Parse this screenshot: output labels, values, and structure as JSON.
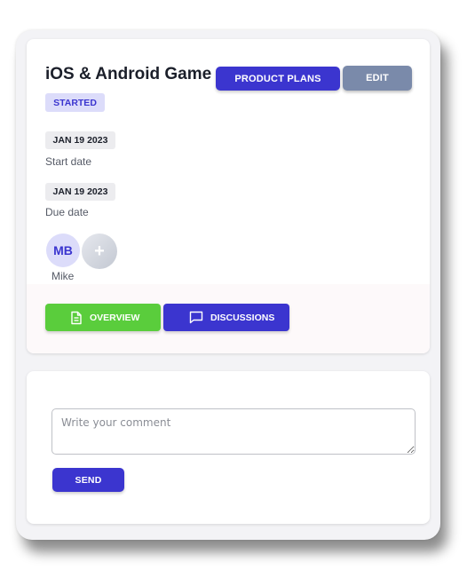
{
  "project": {
    "title": "iOS & Android Game",
    "status": "STARTED",
    "start_date": "JAN 19 2023",
    "start_label": "Start date",
    "due_date": "JAN 19 2023",
    "due_label": "Due date"
  },
  "actions": {
    "product_plans_label": "PRODUCT PLANS",
    "edit_label": "EDIT"
  },
  "members": {
    "avatar_initials": "MB",
    "name": "Mike",
    "add_symbol": "+"
  },
  "tabs": [
    {
      "label": "OVERVIEW",
      "icon": "document-icon",
      "active": true
    },
    {
      "label": "DISCUSSIONS",
      "icon": "chat-bubble-icon",
      "active": false
    }
  ],
  "comment": {
    "placeholder": "Write your comment",
    "value": "",
    "send_label": "SEND"
  },
  "colors": {
    "primary": "#3b35cf",
    "success": "#5acd3c",
    "muted_button": "#7a8aaa",
    "badge_bg": "#dcdcfa"
  }
}
